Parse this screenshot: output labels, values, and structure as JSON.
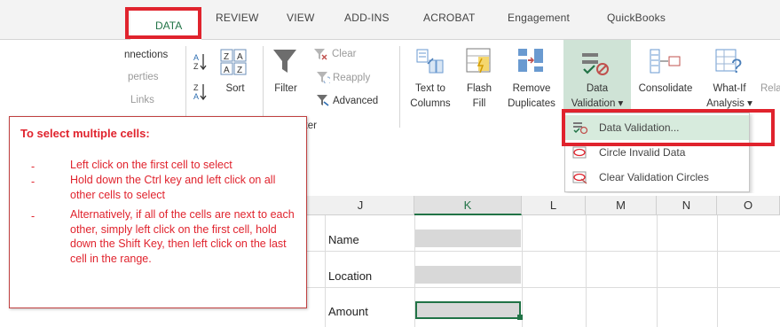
{
  "tabs": [
    {
      "label": "DATA",
      "selected": true
    },
    {
      "label": "REVIEW"
    },
    {
      "label": "VIEW"
    },
    {
      "label": "ADD-INS"
    },
    {
      "label": "ACROBAT"
    },
    {
      "label": "Engagement"
    },
    {
      "label": "QuickBooks"
    }
  ],
  "ribbon": {
    "connections": "nnections",
    "properties": "perties",
    "links": "Links",
    "sort": "Sort",
    "filter": "Filter",
    "clear": "Clear",
    "reapply": "Reapply",
    "advanced": "Advanced",
    "filter_group": "lter",
    "text_to_columns_1": "Text to",
    "text_to_columns_2": "Columns",
    "flash_fill_1": "Flash",
    "flash_fill_2": "Fill",
    "remove_duplicates_1": "Remove",
    "remove_duplicates_2": "Duplicates",
    "data_validation_1": "Data",
    "data_validation_2": "Validation ▾",
    "consolidate": "Consolidate",
    "what_if_1": "What-If",
    "what_if_2": "Analysis ▾",
    "relationships": "Rela"
  },
  "menu": {
    "item1": "Data Validation...",
    "item2": "Circle Invalid Data",
    "item3": "Clear Validation Circles"
  },
  "columns": [
    "J",
    "K",
    "L",
    "M",
    "N",
    "O"
  ],
  "cells": {
    "name": "Name",
    "location": "Location",
    "amount": "Amount"
  },
  "instructions": {
    "title": "To select multiple cells:",
    "bullet": "-",
    "items": [
      "Left click on the first cell to select",
      "Hold down the Ctrl key and left click on all other cells to select",
      "Alternatively, if all of the cells are next to each other, simply left click on the first cell, hold down the Shift Key, then left click on the last cell in the range."
    ]
  },
  "colors": {
    "accent_green": "#217346",
    "annotation_red": "#e0232d"
  }
}
